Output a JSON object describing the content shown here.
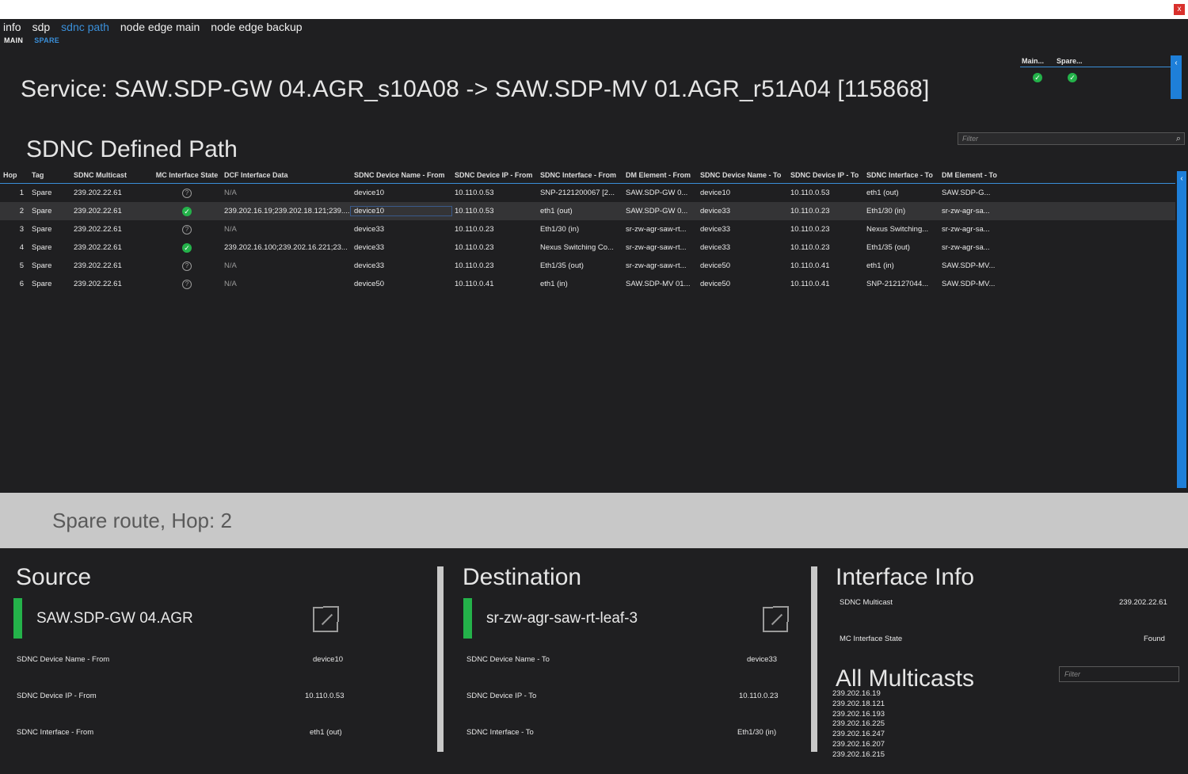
{
  "window": {
    "close_label": "x"
  },
  "tabs": [
    {
      "label": "info",
      "active": false
    },
    {
      "label": "sdp",
      "active": false
    },
    {
      "label": "sdnc path",
      "active": true
    },
    {
      "label": "node edge main",
      "active": false
    },
    {
      "label": "node edge backup",
      "active": false
    }
  ],
  "subtabs": [
    {
      "label": "MAIN",
      "active": false
    },
    {
      "label": "SPARE",
      "active": true
    }
  ],
  "service_title": "Service: SAW.SDP-GW 04.AGR_s10A08 -> SAW.SDP-MV 01.AGR_r51A04 [115868]",
  "status_mini": {
    "headers": [
      "Main...",
      "Spare..."
    ],
    "values": [
      "ok",
      "ok"
    ]
  },
  "section_title": "SDNC Defined Path",
  "filter_top": {
    "placeholder": "Filter"
  },
  "grid": {
    "columns": [
      "Hop",
      "Tag",
      "SDNC Multicast",
      "MC Interface State",
      "DCF Interface Data",
      "SDNC Device Name - From",
      "SDNC Device IP - From",
      "SDNC Interface - From",
      "DM Element - From",
      "SDNC Device Name - To",
      "SDNC Device IP - To",
      "SDNC Interface - To",
      "DM Element - To"
    ],
    "rows": [
      {
        "hop": "1",
        "tag": "Spare",
        "multicast": "239.202.22.61",
        "state": "unknown",
        "dcf": "N/A",
        "dev_from": "device10",
        "ip_from": "10.110.0.53",
        "if_from": "SNP-2121200067 [2...",
        "dm_from": "SAW.SDP-GW 0...",
        "dev_to": "device10",
        "ip_to": "10.110.0.53",
        "if_to": "eth1 (out)",
        "dm_to": "SAW.SDP-G..."
      },
      {
        "hop": "2",
        "tag": "Spare",
        "multicast": "239.202.22.61",
        "state": "ok",
        "dcf": "239.202.16.19;239.202.18.121;239....",
        "dev_from": "device10",
        "ip_from": "10.110.0.53",
        "if_from": "eth1 (out)",
        "dm_from": "SAW.SDP-GW 0...",
        "dev_to": "device33",
        "ip_to": "10.110.0.23",
        "if_to": "Eth1/30 (in)",
        "dm_to": "sr-zw-agr-sa..."
      },
      {
        "hop": "3",
        "tag": "Spare",
        "multicast": "239.202.22.61",
        "state": "unknown",
        "dcf": "N/A",
        "dev_from": "device33",
        "ip_from": "10.110.0.23",
        "if_from": "Eth1/30 (in)",
        "dm_from": "sr-zw-agr-saw-rt...",
        "dev_to": "device33",
        "ip_to": "10.110.0.23",
        "if_to": "Nexus Switching...",
        "dm_to": "sr-zw-agr-sa..."
      },
      {
        "hop": "4",
        "tag": "Spare",
        "multicast": "239.202.22.61",
        "state": "ok",
        "dcf": "239.202.16.100;239.202.16.221;23...",
        "dev_from": "device33",
        "ip_from": "10.110.0.23",
        "if_from": "Nexus Switching Co...",
        "dm_from": "sr-zw-agr-saw-rt...",
        "dev_to": "device33",
        "ip_to": "10.110.0.23",
        "if_to": "Eth1/35 (out)",
        "dm_to": "sr-zw-agr-sa..."
      },
      {
        "hop": "5",
        "tag": "Spare",
        "multicast": "239.202.22.61",
        "state": "unknown",
        "dcf": "N/A",
        "dev_from": "device33",
        "ip_from": "10.110.0.23",
        "if_from": "Eth1/35 (out)",
        "dm_from": "sr-zw-agr-saw-rt...",
        "dev_to": "device50",
        "ip_to": "10.110.0.41",
        "if_to": "eth1 (in)",
        "dm_to": "SAW.SDP-MV..."
      },
      {
        "hop": "6",
        "tag": "Spare",
        "multicast": "239.202.22.61",
        "state": "unknown",
        "dcf": "N/A",
        "dev_from": "device50",
        "ip_from": "10.110.0.41",
        "if_from": "eth1 (in)",
        "dm_from": "SAW.SDP-MV 01...",
        "dev_to": "device50",
        "ip_to": "10.110.0.41",
        "if_to": "SNP-212127044...",
        "dm_to": "SAW.SDP-MV..."
      }
    ]
  },
  "route_bar": "Spare route, Hop: 2",
  "source": {
    "title": "Source",
    "device": "SAW.SDP-GW 04.AGR",
    "fields": [
      {
        "label": "SDNC Device Name - From",
        "value": "device10"
      },
      {
        "label": "SDNC Device IP - From",
        "value": "10.110.0.53"
      },
      {
        "label": "SDNC Interface - From",
        "value": "eth1 (out)"
      }
    ]
  },
  "destination": {
    "title": "Destination",
    "device": "sr-zw-agr-saw-rt-leaf-3",
    "fields": [
      {
        "label": "SDNC Device Name - To",
        "value": "device33"
      },
      {
        "label": "SDNC Device IP - To",
        "value": "10.110.0.23"
      },
      {
        "label": "SDNC Interface - To",
        "value": "Eth1/30 (in)"
      }
    ]
  },
  "interface_info": {
    "title": "Interface Info",
    "fields": [
      {
        "label": "SDNC Multicast",
        "value": "239.202.22.61"
      },
      {
        "label": "MC Interface State",
        "value": "Found"
      }
    ]
  },
  "all_multicasts": {
    "title": "All Multicasts",
    "filter_placeholder": "Filter",
    "items": [
      "239.202.16.19",
      "239.202.18.121",
      "239.202.16.193",
      "239.202.16.225",
      "239.202.16.247",
      "239.202.16.207",
      "239.202.16.215"
    ]
  },
  "colors": {
    "accent": "#3a8fd9",
    "ok": "#24b24a",
    "panel_bg": "#1f1f21"
  }
}
